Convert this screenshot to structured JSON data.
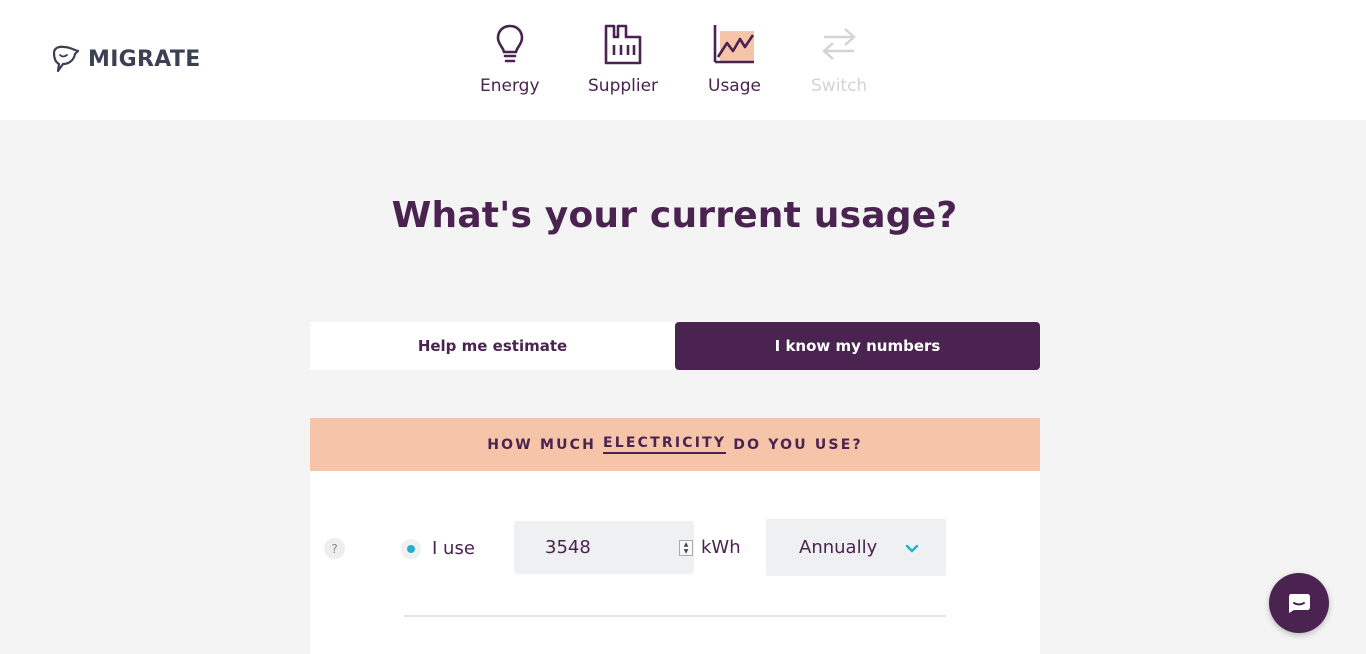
{
  "brand": {
    "name": "MIGRATE"
  },
  "nav": {
    "steps": [
      {
        "label": "Energy",
        "icon": "lightbulb-icon",
        "state": "done"
      },
      {
        "label": "Supplier",
        "icon": "factory-icon",
        "state": "done"
      },
      {
        "label": "Usage",
        "icon": "chart-line-icon",
        "state": "active"
      },
      {
        "label": "Switch",
        "icon": "switch-arrows-icon",
        "state": "disabled"
      }
    ]
  },
  "page": {
    "title": "What's your current usage?"
  },
  "tabs": {
    "estimate_label": "Help me estimate",
    "numbers_label": "I know my numbers",
    "selected": "I know my numbers"
  },
  "electricity": {
    "banner_prefix": "HOW MUCH",
    "banner_emphasis": "ELECTRICITY",
    "banner_suffix": "DO YOU USE?",
    "help_label": "?",
    "use_label": "I use",
    "usage_value": "3548",
    "unit": "kWh",
    "period": "Annually"
  },
  "colors": {
    "primary": "#4a2350",
    "banner": "#f6c4a8",
    "accent": "#1eb3c9",
    "background": "#f3f4f3"
  }
}
